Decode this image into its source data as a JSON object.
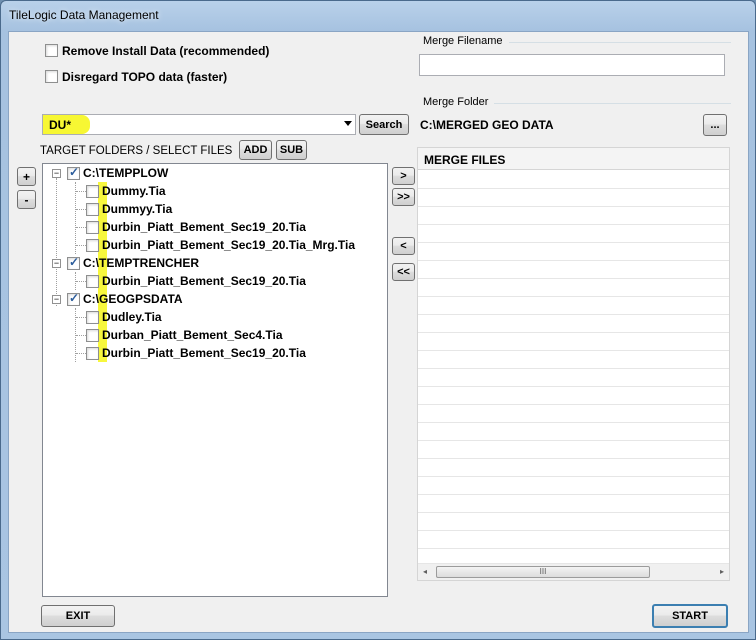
{
  "window": {
    "title": "TileLogic Data Management"
  },
  "options": {
    "remove_install": {
      "label": "Remove Install Data (recommended)",
      "checked": false
    },
    "disregard_topo": {
      "label": "Disregard TOPO data (faster)",
      "checked": false
    }
  },
  "search": {
    "value": "DU*",
    "button_label": "Search"
  },
  "target": {
    "label": "TARGET FOLDERS / SELECT FILES",
    "add_label": "ADD",
    "sub_label": "SUB",
    "expand_label": "+",
    "collapse_label": "-"
  },
  "tree": [
    {
      "folder": "C:\\TEMPPLOW",
      "checked": true,
      "files": [
        "Dummy.Tia",
        "Dummyy.Tia",
        "Durbin_Piatt_Bement_Sec19_20.Tia",
        "Durbin_Piatt_Bement_Sec19_20.Tia_Mrg.Tia"
      ]
    },
    {
      "folder": "C:\\TEMPTRENCHER",
      "checked": true,
      "files": [
        "Durbin_Piatt_Bement_Sec19_20.Tia"
      ]
    },
    {
      "folder": "C:\\GEOGPSDATA",
      "checked": true,
      "files": [
        "Dudley.Tia",
        "Durban_Piatt_Bement_Sec4.Tia",
        "Durbin_Piatt_Bement_Sec19_20.Tia"
      ]
    }
  ],
  "transfer": {
    "add_one": ">",
    "add_all": ">>",
    "remove_one": "<",
    "remove_all": "<<"
  },
  "merge": {
    "filename_label": "Merge Filename",
    "filename_value": "",
    "folder_label": "Merge Folder",
    "folder_value": "C:\\MERGED GEO DATA",
    "browse_label": "...",
    "files_header": "MERGE FILES",
    "scroll_thumb": "III"
  },
  "footer": {
    "exit_label": "EXIT",
    "start_label": "START"
  },
  "colors": {
    "highlight": "#f7f733",
    "check": "#2c5d9c"
  }
}
